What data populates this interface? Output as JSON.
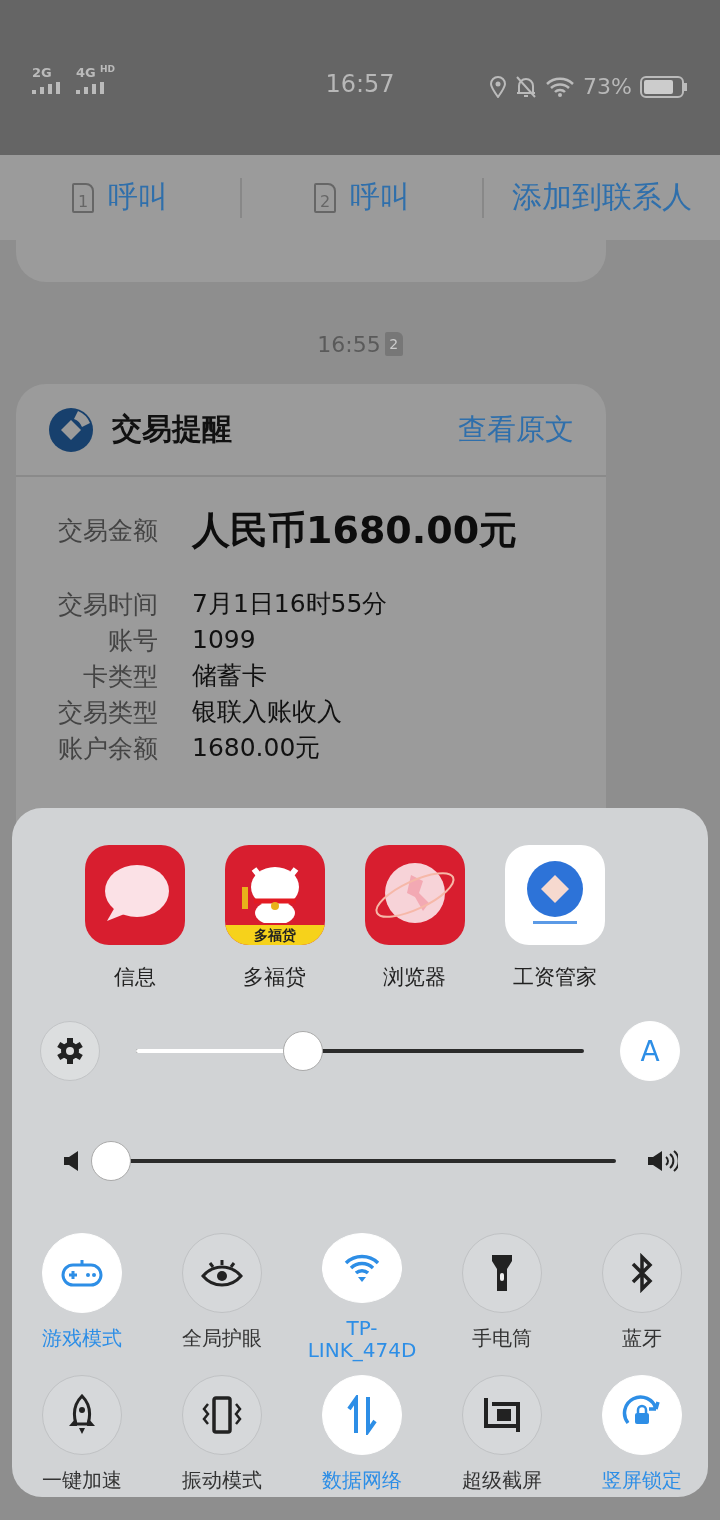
{
  "status_bar": {
    "networks": [
      "2G",
      "4G"
    ],
    "network_badge": "HD",
    "time": "16:57",
    "battery": "73%"
  },
  "action_bar": [
    {
      "sim": "1",
      "label": "呼叫"
    },
    {
      "sim": "2",
      "label": "呼叫"
    },
    {
      "label": "添加到联系人"
    }
  ],
  "timestamp": {
    "time": "16:55",
    "sim": "2"
  },
  "message_card": {
    "title": "交易提醒",
    "link": "查看原文",
    "amount_label": "交易金额",
    "amount": "人民币1680.00元",
    "fields": [
      {
        "label": "交易时间",
        "value": "7月1日16时55分"
      },
      {
        "label": "账号",
        "value": "1099"
      },
      {
        "label": "卡类型",
        "value": "储蓄卡"
      },
      {
        "label": "交易类型",
        "value": "银联入账收入"
      },
      {
        "label": "账户余额",
        "value": "1680.00元"
      }
    ]
  },
  "control_panel": {
    "apps": [
      {
        "name": "信息",
        "kind": "chat"
      },
      {
        "name": "多福贷",
        "kind": "cat",
        "badge_text": "多福贷"
      },
      {
        "name": "浏览器",
        "kind": "globe"
      },
      {
        "name": "工资管家",
        "kind": "diamond"
      }
    ],
    "brightness": {
      "level": 0.37,
      "auto_on": true,
      "auto_label": "A"
    },
    "volume": {
      "level": 0
    },
    "toggles": [
      {
        "label": "游戏模式",
        "kind": "gamepad",
        "on": true
      },
      {
        "label": "全局护眼",
        "kind": "eye",
        "on": false
      },
      {
        "label": "TP-LINK_474D",
        "kind": "wifi",
        "on": true
      },
      {
        "label": "手电筒",
        "kind": "flashlight",
        "on": false
      },
      {
        "label": "蓝牙",
        "kind": "bluetooth",
        "on": false
      },
      {
        "label": "一键加速",
        "kind": "rocket",
        "on": false
      },
      {
        "label": "振动模式",
        "kind": "vibrate",
        "on": false
      },
      {
        "label": "数据网络",
        "kind": "data",
        "on": true
      },
      {
        "label": "超级截屏",
        "kind": "screenshot",
        "on": false
      },
      {
        "label": "竖屏锁定",
        "kind": "rotation",
        "on": true
      }
    ]
  }
}
